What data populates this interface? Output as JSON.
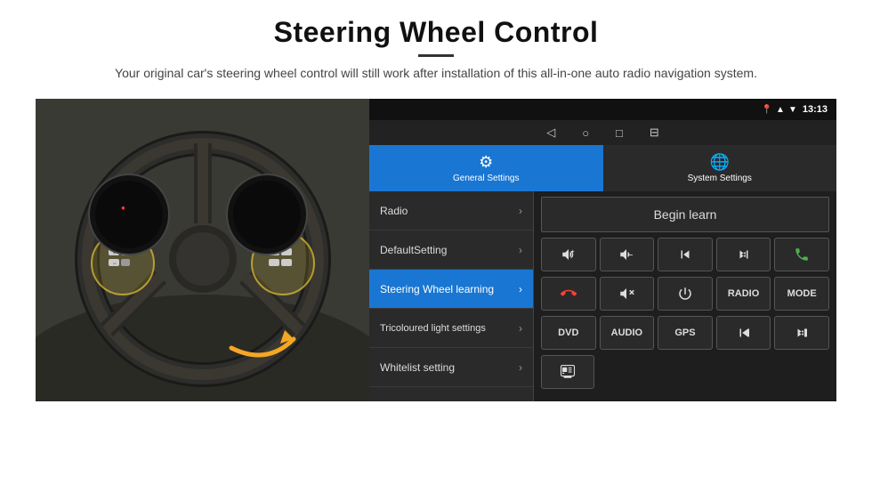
{
  "header": {
    "title": "Steering Wheel Control",
    "divider": true,
    "subtitle": "Your original car's steering wheel control will still work after installation of this all-in-one auto radio navigation system."
  },
  "status_bar": {
    "time": "13:13",
    "wifi_icon": "wifi",
    "signal_icon": "signal",
    "location_icon": "📍"
  },
  "nav_bar": {
    "back_icon": "◁",
    "home_icon": "○",
    "recent_icon": "□",
    "cast_icon": "⊟"
  },
  "tabs": [
    {
      "id": "general",
      "label": "General Settings",
      "active": true,
      "icon": "⚙"
    },
    {
      "id": "system",
      "label": "System Settings",
      "active": false,
      "icon": "🌐"
    }
  ],
  "menu_items": [
    {
      "id": "radio",
      "label": "Radio",
      "active": false
    },
    {
      "id": "default_setting",
      "label": "DefaultSetting",
      "active": false
    },
    {
      "id": "steering_wheel",
      "label": "Steering Wheel learning",
      "active": true
    },
    {
      "id": "tricoloured",
      "label": "Tricoloured light settings",
      "active": false
    },
    {
      "id": "whitelist",
      "label": "Whitelist setting",
      "active": false
    }
  ],
  "control_panel": {
    "begin_learn_label": "Begin learn",
    "row1": [
      {
        "id": "vol_up",
        "symbol": "vol_up"
      },
      {
        "id": "vol_down",
        "symbol": "vol_down"
      },
      {
        "id": "prev_track",
        "symbol": "prev_track"
      },
      {
        "id": "next_track",
        "symbol": "next_track"
      },
      {
        "id": "phone",
        "symbol": "phone"
      }
    ],
    "row2": [
      {
        "id": "hang_up",
        "symbol": "hang_up"
      },
      {
        "id": "mute",
        "symbol": "mute"
      },
      {
        "id": "power",
        "symbol": "power"
      },
      {
        "id": "radio_btn",
        "label": "RADIO"
      },
      {
        "id": "mode_btn",
        "label": "MODE"
      }
    ],
    "row3": [
      {
        "id": "dvd_btn",
        "label": "DVD"
      },
      {
        "id": "audio_btn",
        "label": "AUDIO"
      },
      {
        "id": "gps_btn",
        "label": "GPS"
      },
      {
        "id": "prev_folder",
        "symbol": "prev_folder"
      },
      {
        "id": "next_folder",
        "symbol": "next_folder"
      }
    ],
    "row4": [
      {
        "id": "nav_btn",
        "symbol": "nav_icon"
      }
    ]
  }
}
